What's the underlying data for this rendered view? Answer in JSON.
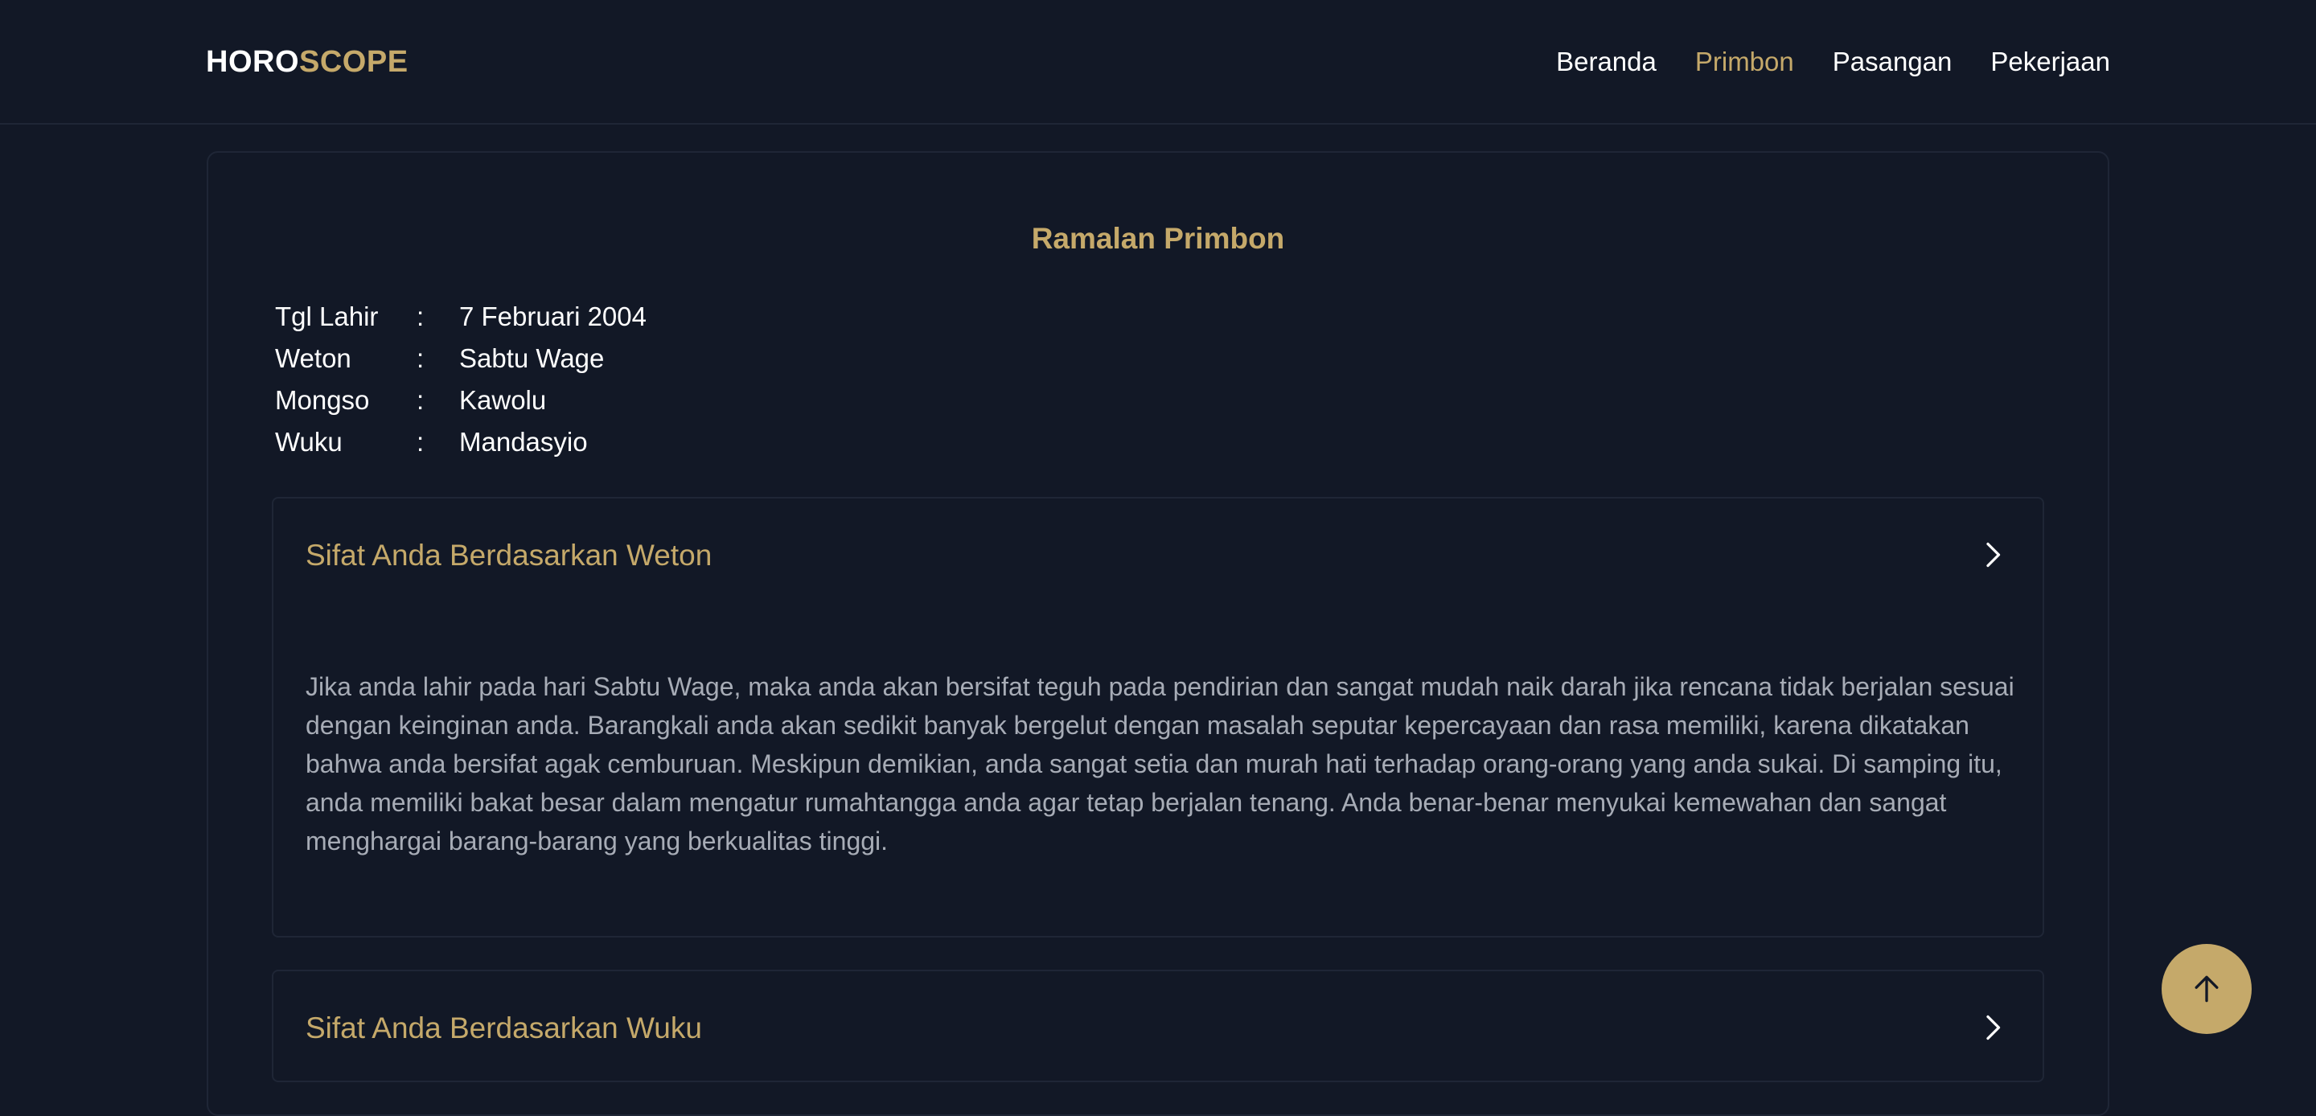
{
  "brand": {
    "part1": "HORO",
    "part2": "SCOPE"
  },
  "nav": {
    "items": [
      "Beranda",
      "Primbon",
      "Pasangan",
      "Pekerjaan"
    ],
    "active": "Primbon"
  },
  "page": {
    "title": "Ramalan Primbon"
  },
  "info": [
    {
      "key": "Tgl Lahir",
      "sep": ":",
      "value": "7 Februari 2004"
    },
    {
      "key": "Weton",
      "sep": ":",
      "value": "Sabtu Wage"
    },
    {
      "key": "Mongso",
      "sep": ":",
      "value": "Kawolu"
    },
    {
      "key": "Wuku",
      "sep": ":",
      "value": "Mandasyio"
    }
  ],
  "accordion": [
    {
      "title": "Sifat Anda Berdasarkan Weton",
      "body": "Jika anda lahir pada hari Sabtu Wage, maka anda akan bersifat teguh pada pendirian dan sangat mudah naik darah jika rencana tidak berjalan sesuai dengan keinginan anda. Barangkali anda akan sedikit banyak bergelut dengan masalah seputar kepercayaan dan rasa memiliki, karena dikatakan bahwa anda bersifat agak cemburuan. Meskipun demikian, anda sangat setia dan murah hati terhadap orang-orang yang anda sukai. Di samping itu, anda memiliki bakat besar dalam mengatur rumahtangga anda agar tetap berjalan tenang. Anda benar-benar menyukai kemewahan dan sangat menghargai barang-barang yang berkualitas tinggi."
    },
    {
      "title": "Sifat Anda Berdasarkan Wuku",
      "body": ""
    }
  ],
  "colors": {
    "background": "#121826",
    "accent": "#c5a96a",
    "border": "#1f2636",
    "muted_text": "#a7acb6"
  },
  "icons": {
    "chevron": "chevron-right-icon",
    "scroll_top": "arrow-up-icon"
  }
}
